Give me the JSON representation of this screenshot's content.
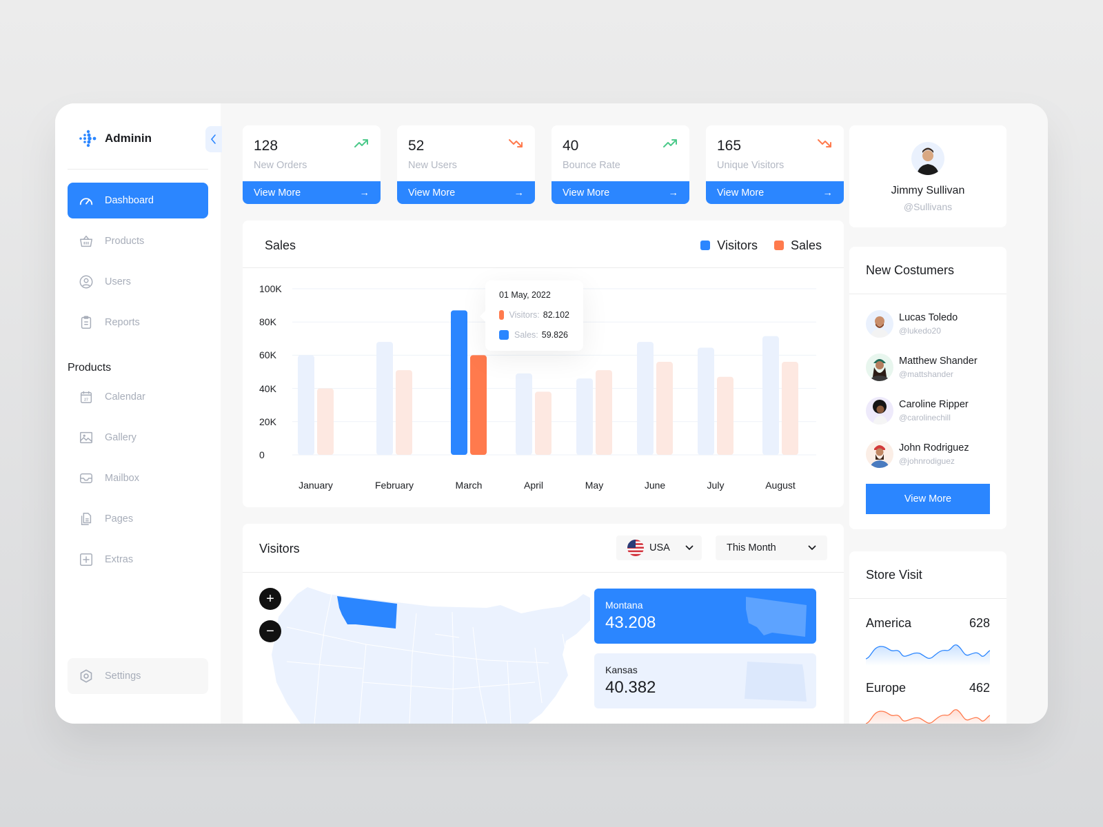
{
  "app": {
    "name": "Adminin"
  },
  "sidebar": {
    "items": [
      {
        "label": "Dashboard",
        "icon": "gauge-icon",
        "active": true
      },
      {
        "label": "Products",
        "icon": "basket-icon"
      },
      {
        "label": "Users",
        "icon": "user-circle-icon"
      },
      {
        "label": "Reports",
        "icon": "clipboard-icon"
      }
    ],
    "section_title": "Products",
    "section_items": [
      {
        "label": "Calendar",
        "icon": "calendar-icon",
        "badge": "27"
      },
      {
        "label": "Gallery",
        "icon": "image-icon"
      },
      {
        "label": "Mailbox",
        "icon": "inbox-icon"
      },
      {
        "label": "Pages",
        "icon": "pages-icon"
      },
      {
        "label": "Extras",
        "icon": "plus-square-icon"
      }
    ],
    "settings_label": "Settings"
  },
  "stats": [
    {
      "value": "128",
      "label": "New Orders",
      "trend": "up",
      "action": "View More"
    },
    {
      "value": "52",
      "label": "New Users",
      "trend": "down",
      "action": "View More"
    },
    {
      "value": "40",
      "label": "Bounce Rate",
      "trend": "up",
      "action": "View More"
    },
    {
      "value": "165",
      "label": "Unique Visitors",
      "trend": "down",
      "action": "View More"
    }
  ],
  "colors": {
    "primary": "#2b86ff",
    "accent": "#ff7a4d",
    "up": "#4cc98a",
    "down": "#ff7a4d",
    "visitors_faded": "#eaf1fd",
    "sales_faded": "#fde8e1"
  },
  "sales": {
    "title": "Sales",
    "tooltip": {
      "date": "01 May, 2022",
      "visitors_label": "Visitors:",
      "visitors_value": "82.102",
      "sales_label": "Sales:",
      "sales_value": "59.826"
    }
  },
  "chart_data": {
    "type": "bar",
    "title": "Sales",
    "categories": [
      "January",
      "February",
      "March",
      "April",
      "May",
      "June",
      "July",
      "August"
    ],
    "series": [
      {
        "name": "Visitors",
        "values": [
          60,
          68,
          87,
          49,
          46,
          68,
          64.5,
          71.5
        ]
      },
      {
        "name": "Sales",
        "values": [
          40,
          51,
          60,
          38,
          51,
          56,
          47,
          56
        ]
      }
    ],
    "highlighted_category": "March",
    "yticks": [
      "0",
      "20K",
      "40K",
      "60K",
      "80K",
      "100K"
    ],
    "ylim": [
      0,
      100
    ],
    "yunit": "K",
    "xlabel": "",
    "ylabel": "",
    "grid": true,
    "legend": "top-right"
  },
  "visitors": {
    "title": "Visitors",
    "country": "USA",
    "period": "This Month",
    "states": [
      {
        "name": "Montana",
        "value": "43.208",
        "highlighted": true
      },
      {
        "name": "Kansas",
        "value": "40.382",
        "highlighted": false
      }
    ]
  },
  "profile": {
    "name": "Jimmy Sullivan",
    "handle": "@Sullivans"
  },
  "customers": {
    "title": "New Costumers",
    "items": [
      {
        "name": "Lucas Toledo",
        "handle": "@lukedo20"
      },
      {
        "name": "Matthew Shander",
        "handle": "@mattshander"
      },
      {
        "name": "Caroline Ripper",
        "handle": "@carolinechill"
      },
      {
        "name": "John Rodriguez",
        "handle": "@johnrodiguez"
      }
    ],
    "action": "View More"
  },
  "store_visit": {
    "title": "Store Visit",
    "regions": [
      {
        "name": "America",
        "value": "628"
      },
      {
        "name": "Europe",
        "value": "462"
      }
    ]
  }
}
